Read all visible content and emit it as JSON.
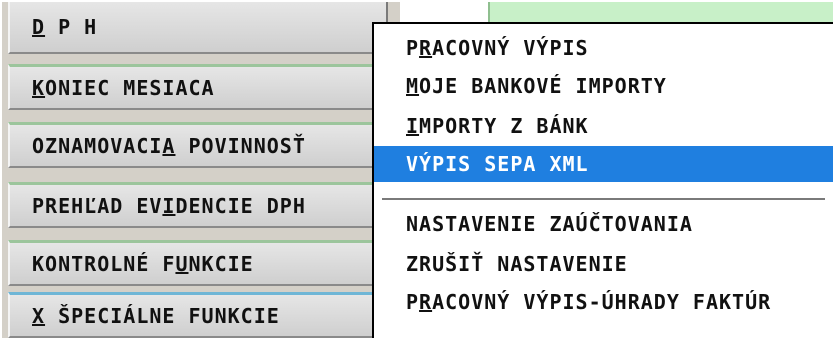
{
  "left_menu": [
    {
      "label": "D P H"
    },
    {
      "label": "KONIEC MESIACA"
    },
    {
      "label": "OZNAMOVACIA POVINNOSŤ"
    },
    {
      "label": "PREHĽAD EVIDENCIE DPH"
    },
    {
      "label": "KONTROLNÉ FUNKCIE"
    },
    {
      "label": "X ŠPECIÁLNE FUNKCIE"
    }
  ],
  "popup_menu": {
    "items": [
      {
        "label": "PRACOVNÝ VÝPIS"
      },
      {
        "label": "MOJE BANKOVÉ IMPORTY"
      },
      {
        "label": "IMPORTY Z BÁNK"
      },
      {
        "label": "VÝPIS SEPA XML",
        "selected": true
      },
      {
        "label": "NASTAVENIE ZAÚČTOVANIA"
      },
      {
        "label": "ZRUŠIŤ NASTAVENIE"
      },
      {
        "label": "PRACOVNÝ VÝPIS-ÚHRADY FAKTÚR"
      }
    ]
  },
  "colors": {
    "selection": "#1f7fe0",
    "background_strip": "#c8f0c8"
  }
}
